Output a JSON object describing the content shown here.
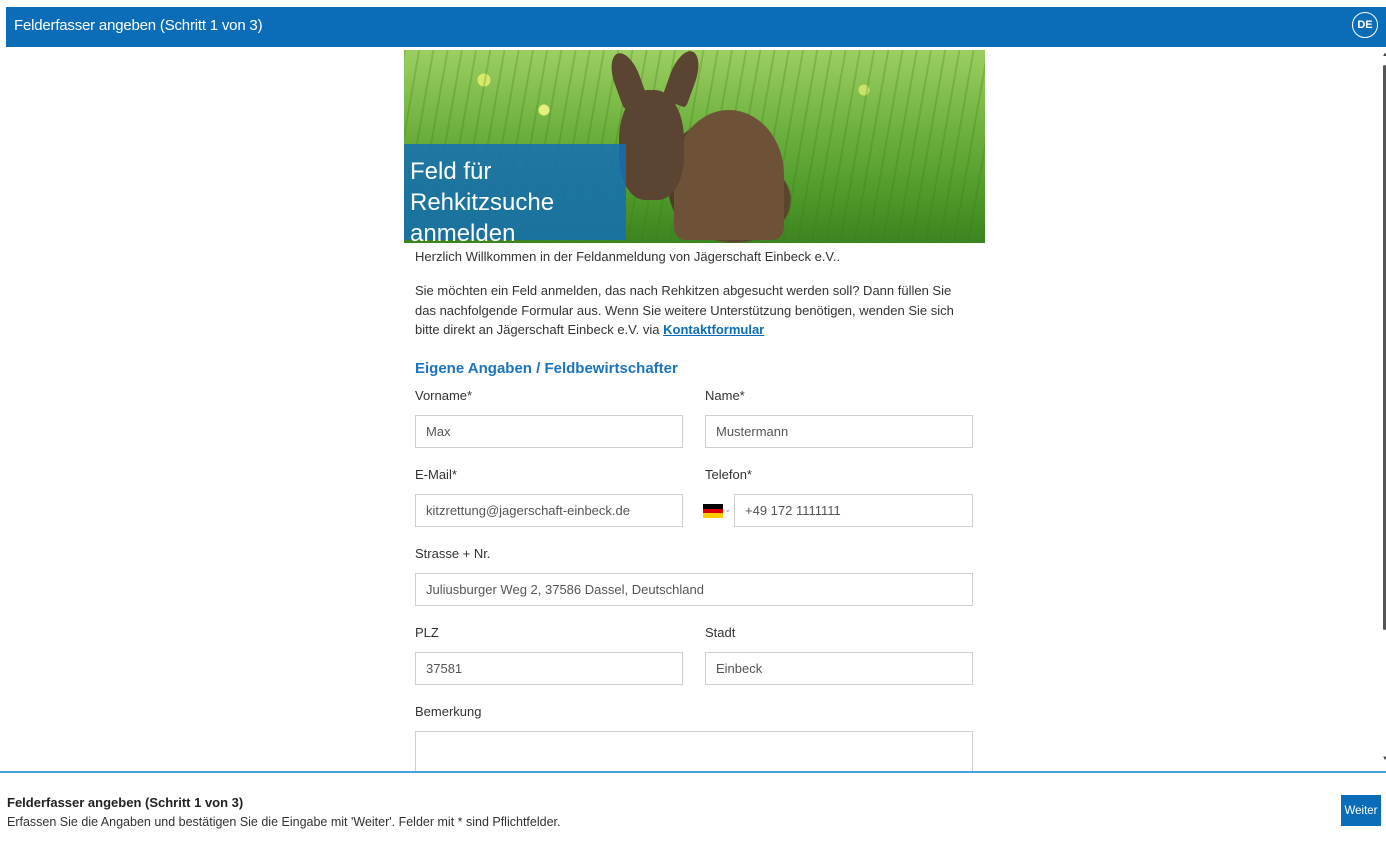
{
  "header": {
    "title": "Felderfasser angeben (Schritt 1 von 3)",
    "language": "DE"
  },
  "hero": {
    "caption": "Feld für Rehkitzsuche anmelden"
  },
  "intro": {
    "welcome": "Herzlich Willkommen in der Feldanmeldung von Jägerschaft Einbeck e.V..",
    "text": "Sie möchten ein Feld anmelden, das nach Rehkitzen abgesucht werden soll? Dann füllen Sie das nachfolgende Formular aus. Wenn Sie weitere Unterstützung benötigen, wenden Sie sich bitte direkt an Jägerschaft Einbeck e.V. via ",
    "link": "Kontaktformular"
  },
  "section_title": "Eigene Angaben / Feldbewirtschafter",
  "form": {
    "firstname": {
      "label": "Vorname*",
      "value": "Max"
    },
    "lastname": {
      "label": "Name*",
      "value": "Mustermann"
    },
    "email": {
      "label": "E-Mail*",
      "value": "kitzrettung@jagerschaft-einbeck.de"
    },
    "phone": {
      "label": "Telefon*",
      "value": "+49 172 1111111",
      "country_icon": "flag-de-icon"
    },
    "street": {
      "label": "Strasse + Nr.",
      "value": "Juliusburger Weg 2, 37586 Dassel, Deutschland"
    },
    "zip": {
      "label": "PLZ",
      "value": "37581"
    },
    "city": {
      "label": "Stadt",
      "value": "Einbeck"
    },
    "remark": {
      "label": "Bemerkung",
      "value": ""
    }
  },
  "footer": {
    "title": "Felderfasser angeben (Schritt 1 von 3)",
    "subtitle": "Erfassen Sie die Angaben und bestätigen Sie die Eingabe mit 'Weiter'. Felder mit * sind Pflichtfelder.",
    "next_label": "Weiter"
  },
  "colors": {
    "primary": "#0b6db8",
    "section": "#1a74be",
    "footer_border": "#4aa3df"
  }
}
